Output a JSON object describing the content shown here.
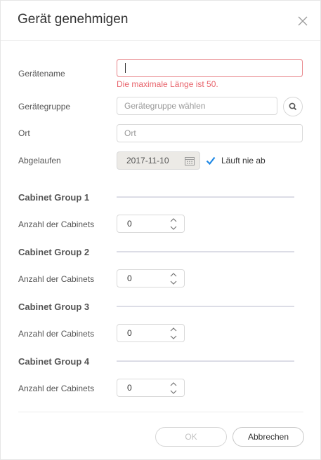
{
  "dialog": {
    "title": "Gerät genehmigen",
    "close_icon": "close-icon"
  },
  "form": {
    "device_name": {
      "label": "Gerätename",
      "value": "",
      "error": "Die maximale Länge ist 50."
    },
    "device_group": {
      "label": "Gerätegruppe",
      "placeholder": "Gerätegruppe wählen",
      "search_icon": "search-icon"
    },
    "location": {
      "label": "Ort",
      "placeholder": "Ort"
    },
    "expires": {
      "label": "Abgelaufen",
      "date": "2017-11-10",
      "calendar_icon": "calendar-icon",
      "never_label": "Läuft nie ab",
      "never_checked": true
    }
  },
  "cabinet_groups": [
    {
      "title": "Cabinet Group 1",
      "count_label": "Anzahl der Cabinets",
      "count": "0"
    },
    {
      "title": "Cabinet Group 2",
      "count_label": "Anzahl der Cabinets",
      "count": "0"
    },
    {
      "title": "Cabinet Group 3",
      "count_label": "Anzahl der Cabinets",
      "count": "0"
    },
    {
      "title": "Cabinet Group 4",
      "count_label": "Anzahl der Cabinets",
      "count": "0"
    }
  ],
  "footer": {
    "ok_label": "OK",
    "cancel_label": "Abbrechen"
  },
  "colors": {
    "accent": "#1e88e5",
    "error": "#e8636b",
    "divider": "#dcdde6",
    "disabled_field": "#eceae6"
  }
}
